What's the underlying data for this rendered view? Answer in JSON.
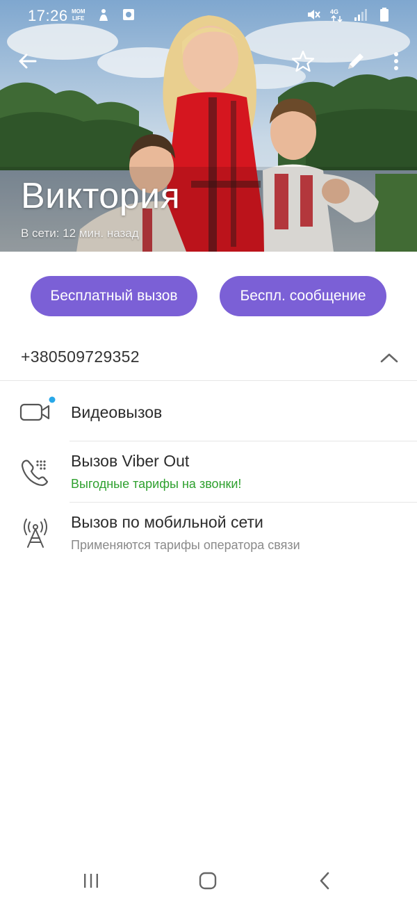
{
  "status_bar": {
    "time": "17:26",
    "left_icons": [
      "momlife-app-icon",
      "alert-app-icon",
      "gallery-app-icon"
    ],
    "right_icons": [
      "mute-icon",
      "4g-data-icon",
      "signal-icon",
      "battery-icon"
    ]
  },
  "header": {
    "name": "Виктория",
    "last_seen": "В сети: 12 мин. назад",
    "icons": [
      "back-arrow-icon",
      "star-icon",
      "pencil-icon",
      "more-vert-icon"
    ]
  },
  "actions": {
    "free_call_label": "Бесплатный вызов",
    "free_message_label": "Беспл. сообщение",
    "accent_color": "#7b60d6"
  },
  "phone": {
    "number": "+380509729352"
  },
  "options": [
    {
      "title": "Видеовызов",
      "subtitle": "",
      "icon": "video-camera-icon",
      "has_dot": true,
      "dot_color": "#29a8e8"
    },
    {
      "title": "Вызов Viber Out",
      "subtitle": "Выгодные тарифы на звонки!",
      "subtitle_color": "#2ea02e",
      "icon": "phone-keypad-icon"
    },
    {
      "title": "Вызов по мобильной сети",
      "subtitle": "Применяются тарифы оператора связи",
      "subtitle_color": "#8a8a8a",
      "icon": "antenna-icon"
    }
  ],
  "nav_bar": {
    "icons": [
      "recents-icon",
      "home-icon",
      "nav-back-icon"
    ]
  }
}
